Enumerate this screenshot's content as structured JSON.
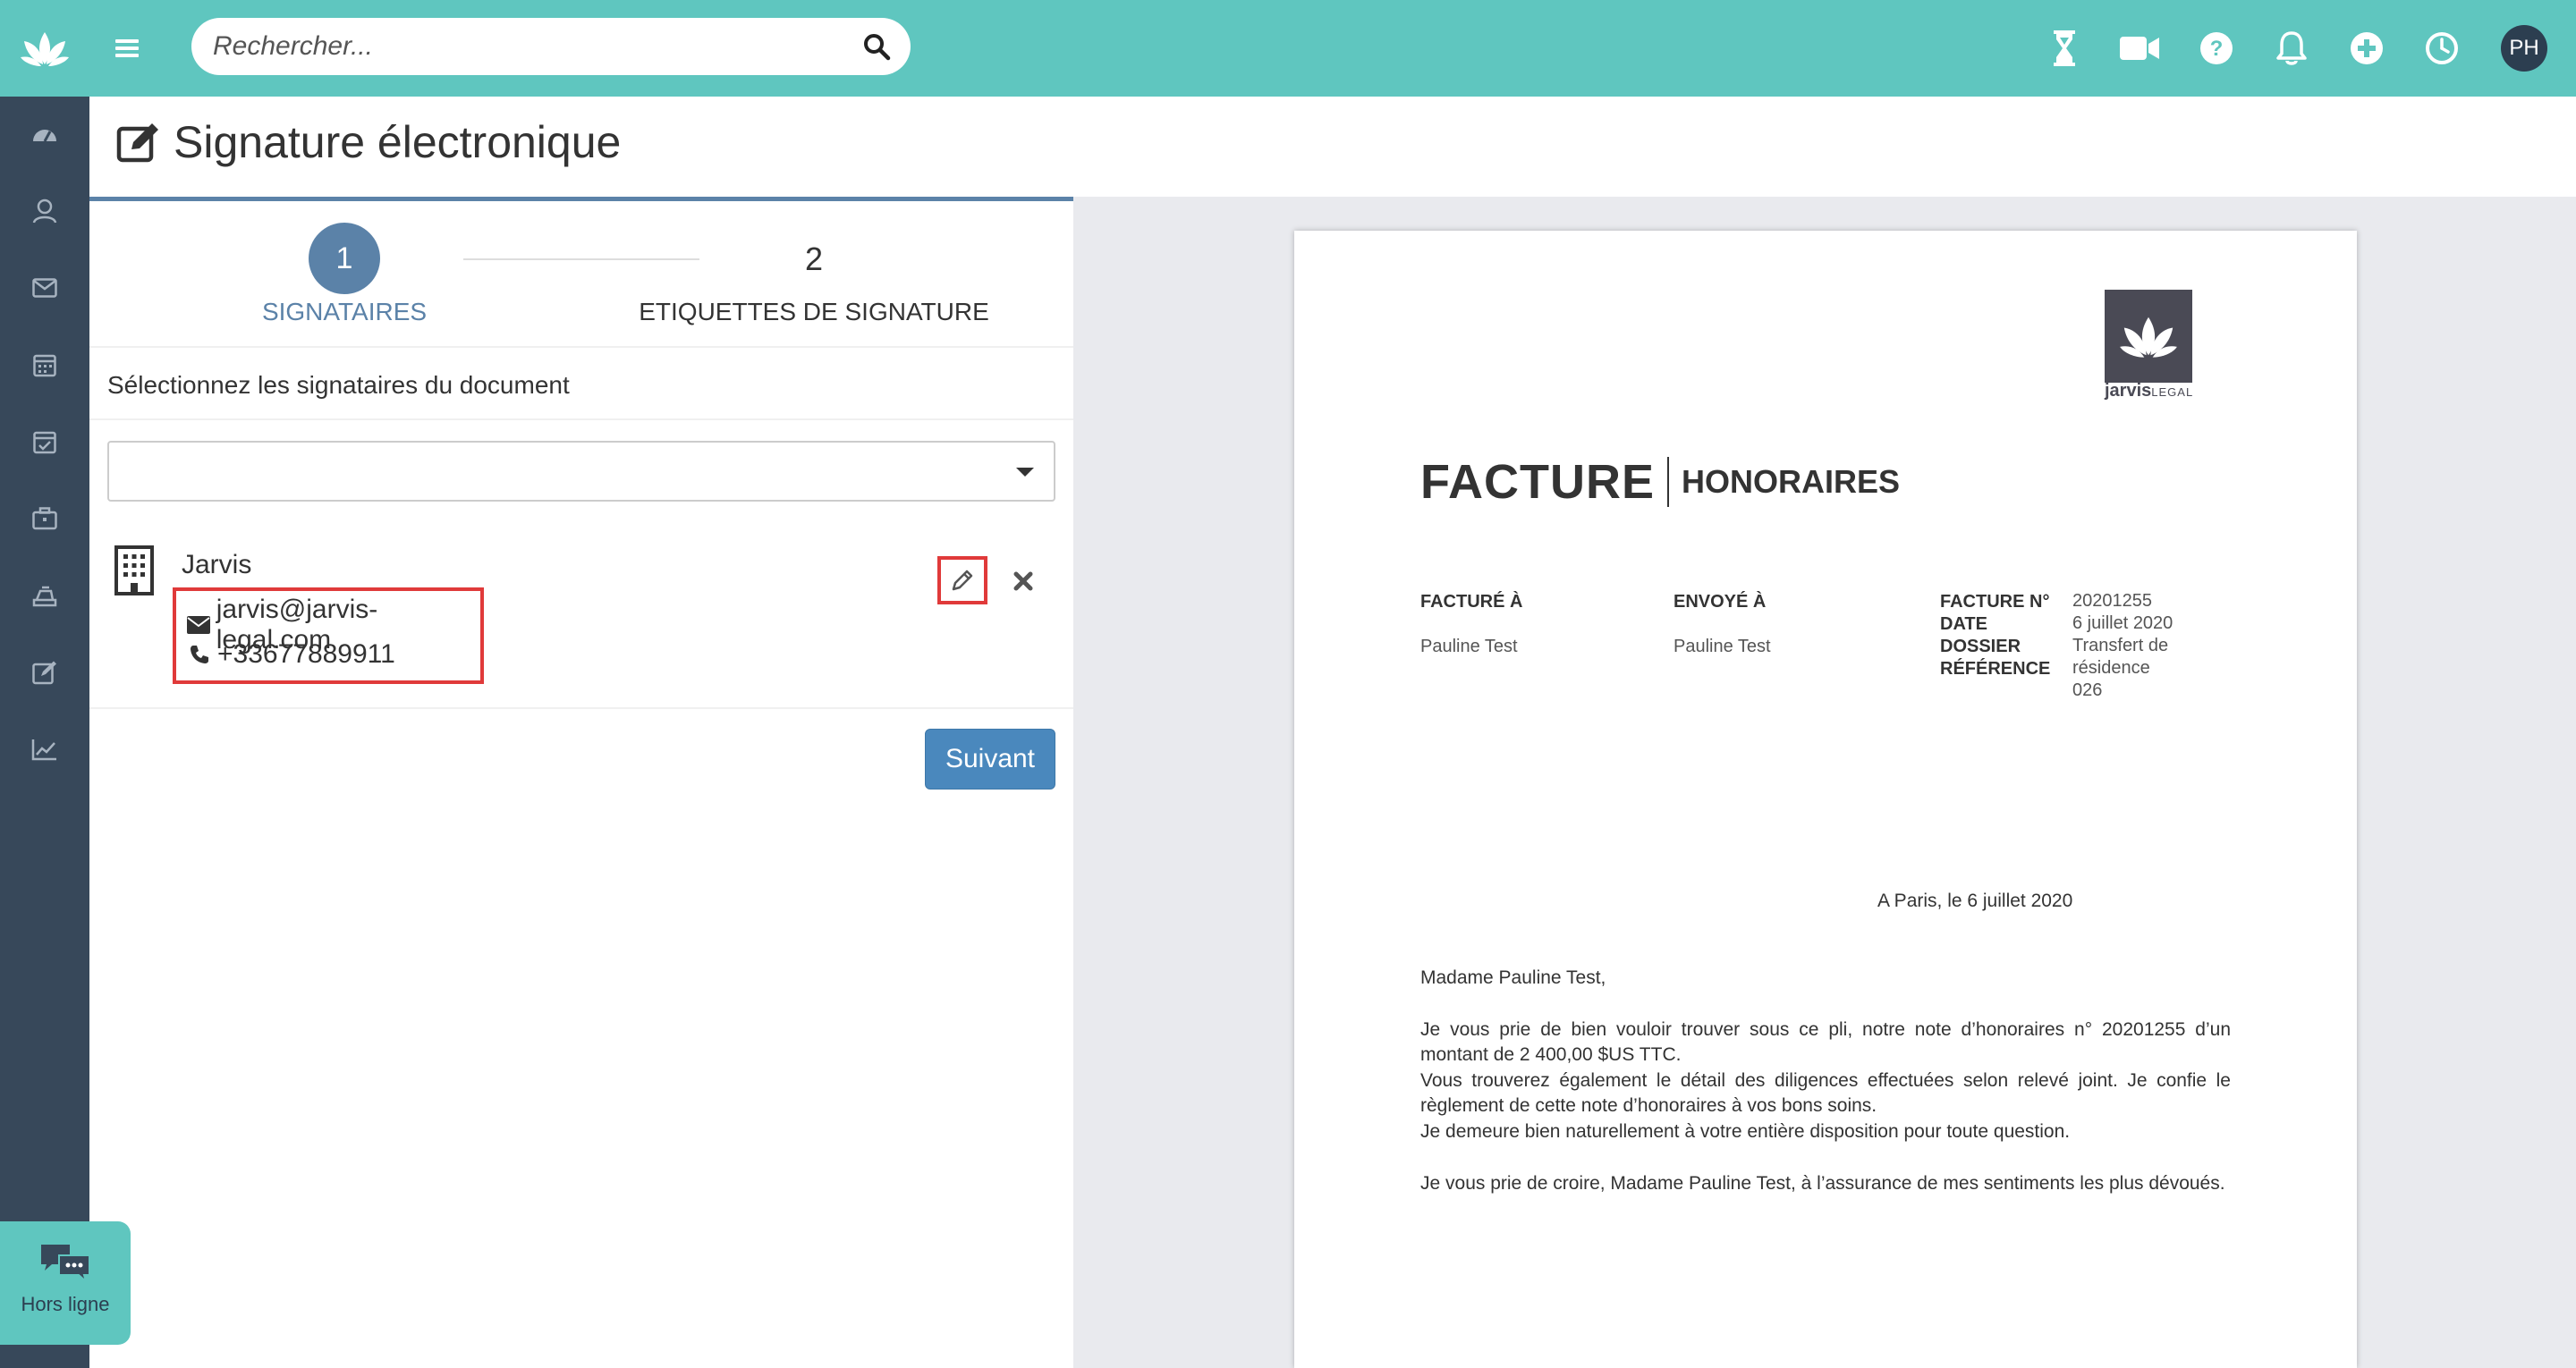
{
  "topbar": {
    "search_placeholder": "Rechercher...",
    "avatar_initials": "PH",
    "icons": [
      "hourglass-icon",
      "video-camera-icon",
      "help-icon",
      "bell-icon",
      "plus-circle-icon",
      "clock-icon"
    ]
  },
  "sidebar": {
    "items": [
      "dashboard-icon",
      "contacts-icon",
      "mail-icon",
      "calendar-icon",
      "tasks-icon",
      "briefcase-icon",
      "billing-icon",
      "signature-icon",
      "reports-icon"
    ]
  },
  "page": {
    "title": "Signature électronique"
  },
  "steps": [
    {
      "number": "1",
      "label": "SIGNATAIRES"
    },
    {
      "number": "2",
      "label": "ETIQUETTES DE SIGNATURE"
    }
  ],
  "signers": {
    "prompt": "Sélectionnez les signataires du document",
    "select_value": "",
    "entry": {
      "name": "Jarvis",
      "email": "jarvis@jarvis-legal.com",
      "phone": "+33677889911"
    },
    "next_label": "Suivant"
  },
  "document": {
    "logo_text_bold": "jarvis",
    "logo_text_light": "LEGAL",
    "title_main": "FACTURE",
    "title_sub": "HONORAIRES",
    "billed_to_label": "FACTURÉ À",
    "billed_to_value": "Pauline Test",
    "sent_to_label": "ENVOYÉ À",
    "sent_to_value": "Pauline Test",
    "invoice_no_label": "FACTURE N°",
    "invoice_no_value": "20201255",
    "date_label": "DATE",
    "date_value": "6 juillet 2020",
    "file_label": "DOSSIER",
    "file_value_1": "Transfert de",
    "ref_label": "RÉFÉRENCE",
    "file_value_2": "résidence",
    "file_value_3": "026",
    "letter_date": "A Paris, le 6 juillet 2020",
    "salutation": "Madame Pauline Test,",
    "para1": "Je vous prie de bien vouloir trouver sous ce pli, notre note d’honoraires n° 20201255 d’un montant de 2 400,00 $US TTC.",
    "para2": "Vous trouverez également le détail des diligences effectuées selon relevé joint. Je confie le règlement de cette note d’honoraires à vos bons soins.",
    "para3": "Je demeure bien naturellement à votre entière disposition pour toute question.",
    "para4": "Je vous prie de croire, Madame Pauline Test, à l’assurance de mes sentiments les plus dévoués."
  },
  "chat": {
    "status": "Hors ligne"
  },
  "colors": {
    "topbar": "#5fc6bf",
    "sidebar": "#37485a",
    "accent": "#5b82a8",
    "button": "#4a88bd",
    "highlight": "#e03a3a"
  }
}
